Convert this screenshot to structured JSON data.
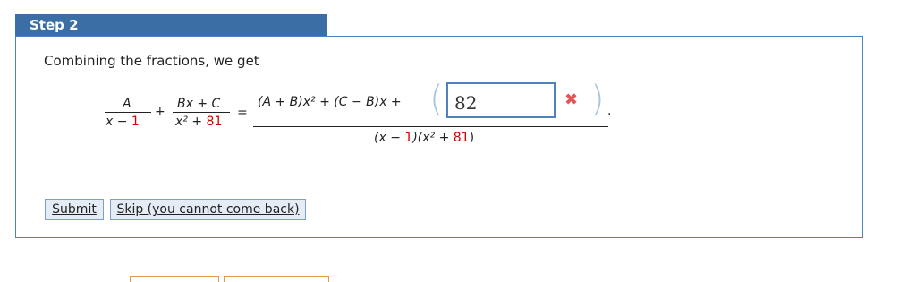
{
  "step": {
    "title": "Step 2"
  },
  "intro_text": "Combining the fractions, we get",
  "equation": {
    "frac1_num": "A",
    "frac1_den_pre": "x − ",
    "frac1_den_red": "1",
    "plus": "+",
    "frac2_num": "Bx + C",
    "frac2_den_pre": "x² + ",
    "frac2_den_red": "81",
    "equals": "=",
    "rhs_num": "(A + B)x² + (C − B)x +",
    "rhs_den_pre": "(x − ",
    "rhs_den_red1": "1",
    "rhs_den_mid": ")(x² + ",
    "rhs_den_red2": "81",
    "rhs_den_post": ")",
    "period": "."
  },
  "answer_input": {
    "value": "82",
    "status_icon": "x-mark-icon",
    "status_color": "#e05555"
  },
  "buttons": {
    "submit": "Submit",
    "skip": "Skip (you cannot come back)"
  },
  "colors": {
    "header": "#3a6ea5",
    "border": "#4f81bd",
    "highlight": "#d40000"
  }
}
